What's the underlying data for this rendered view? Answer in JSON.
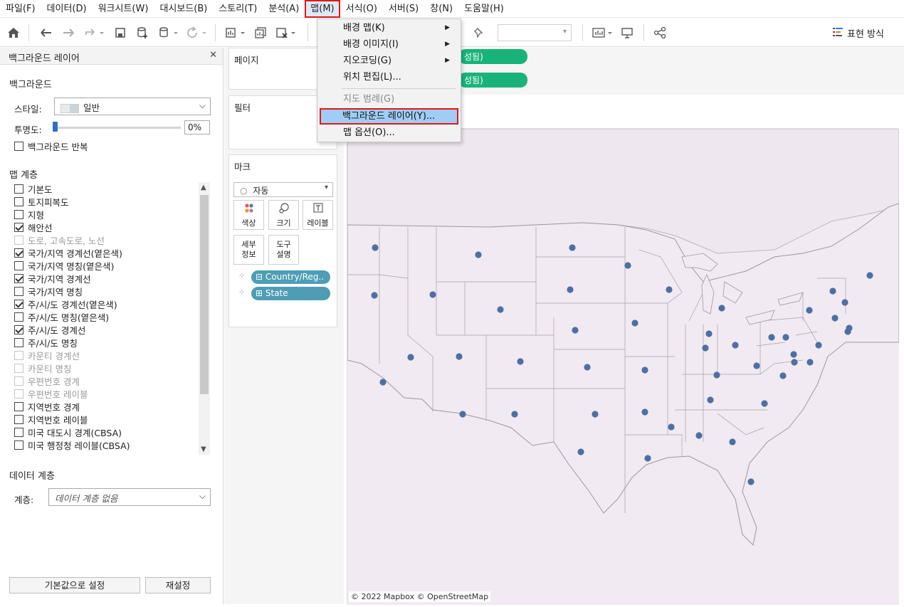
{
  "menubar": {
    "items": [
      "파일(F)",
      "데이터(D)",
      "워크시트(W)",
      "대시보드(B)",
      "스토리(T)",
      "분석(A)",
      "맵(M)",
      "서식(O)",
      "서버(S)",
      "창(N)",
      "도움말(H)"
    ]
  },
  "toolbar": {
    "show_me_label": "표현 방식"
  },
  "map_menu": {
    "items": [
      {
        "label": "배경 맵(K)",
        "submenu": true,
        "disabled": false
      },
      {
        "label": "배경 이미지(I)",
        "submenu": true,
        "disabled": false
      },
      {
        "label": "지오코딩(G)",
        "submenu": true,
        "disabled": false
      },
      {
        "label": "위치 편집(L)...",
        "submenu": false,
        "disabled": false
      },
      {
        "label": "지도 범례(G)",
        "submenu": false,
        "disabled": true
      },
      {
        "label": "백그라운드 레이어(Y)...",
        "submenu": false,
        "disabled": false,
        "highlighted": true
      },
      {
        "label": "맵 옵션(O)...",
        "submenu": false,
        "disabled": false
      }
    ]
  },
  "background_layers": {
    "panel_title": "백그라운드 레이어",
    "background_heading": "백그라운드",
    "style_label": "스타일:",
    "style_value": "일반",
    "opacity_label": "투명도:",
    "opacity_value": "0%",
    "opacity_level": 0,
    "repeat_label": "백그라운드 반복",
    "repeat_checked": false,
    "map_layers_heading": "맵 계층",
    "layers": [
      {
        "label": "기본도",
        "checked": false,
        "disabled": false
      },
      {
        "label": "토지피복도",
        "checked": false,
        "disabled": false
      },
      {
        "label": "지형",
        "checked": false,
        "disabled": false
      },
      {
        "label": "해안선",
        "checked": true,
        "disabled": false
      },
      {
        "label": "도로, 고속도로, 노선",
        "checked": false,
        "disabled": true
      },
      {
        "label": "국가/지역 경계선(옅은색)",
        "checked": true,
        "disabled": false
      },
      {
        "label": "국가/지역 명칭(옅은색)",
        "checked": false,
        "disabled": false
      },
      {
        "label": "국가/지역 경계선",
        "checked": true,
        "disabled": false
      },
      {
        "label": "국가/지역 명칭",
        "checked": false,
        "disabled": false
      },
      {
        "label": "주/시/도 경계선(옅은색)",
        "checked": true,
        "disabled": false
      },
      {
        "label": "주/시/도 명칭(옅은색)",
        "checked": false,
        "disabled": false
      },
      {
        "label": "주/시/도 경계선",
        "checked": true,
        "disabled": false
      },
      {
        "label": "주/시/도 명칭",
        "checked": false,
        "disabled": false
      },
      {
        "label": "카운티 경계선",
        "checked": false,
        "disabled": true
      },
      {
        "label": "카운티 명칭",
        "checked": false,
        "disabled": true
      },
      {
        "label": "우편번호 경계",
        "checked": false,
        "disabled": true
      },
      {
        "label": "우편번호 레이블",
        "checked": false,
        "disabled": true
      },
      {
        "label": "지역번호 경계",
        "checked": false,
        "disabled": false
      },
      {
        "label": "지역번호 레이블",
        "checked": false,
        "disabled": false
      },
      {
        "label": "미국 대도시 경계(CBSA)",
        "checked": false,
        "disabled": false
      },
      {
        "label": "미국 행정청 레이블(CBSA)",
        "checked": false,
        "disabled": false
      }
    ],
    "data_layer_heading": "데이터 계층",
    "data_layer_label": "계층:",
    "data_layer_value": "데이터 계층 없음",
    "default_button": "기본값으로 설정",
    "reset_button": "재설정"
  },
  "shelves": {
    "pages_title": "페이지",
    "filters_title": "필터",
    "marks_title": "마크",
    "mark_type": "자동",
    "mark_buttons": [
      "색상",
      "크기",
      "레이블",
      "세부\n정보",
      "도구\n설명"
    ],
    "pills": [
      "Country/Reg..",
      "State"
    ]
  },
  "rows_area": {
    "pill1": "성됨)",
    "pill2": "성됨)"
  },
  "map": {
    "background_color": "#f2eaf2",
    "copyright": "© 2022 Mapbox © OpenStreetMap"
  }
}
